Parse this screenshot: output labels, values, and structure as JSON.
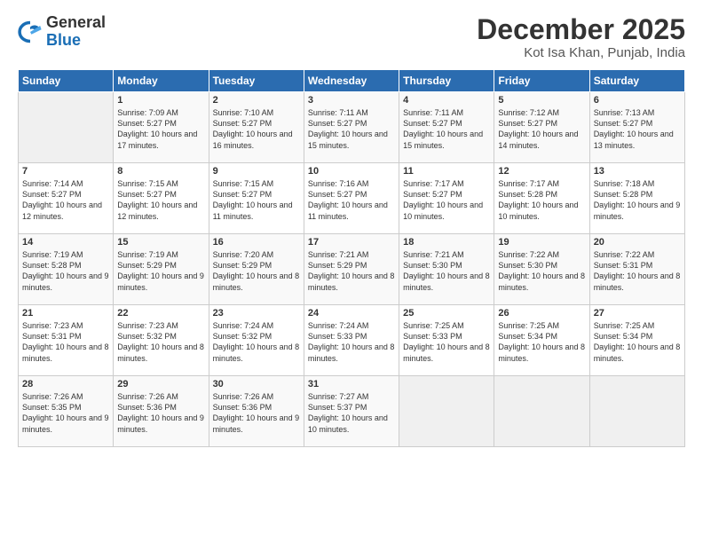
{
  "logo": {
    "general": "General",
    "blue": "Blue"
  },
  "title": "December 2025",
  "location": "Kot Isa Khan, Punjab, India",
  "days_of_week": [
    "Sunday",
    "Monday",
    "Tuesday",
    "Wednesday",
    "Thursday",
    "Friday",
    "Saturday"
  ],
  "weeks": [
    [
      {
        "day": "",
        "sunrise": "",
        "sunset": "",
        "daylight": ""
      },
      {
        "day": "1",
        "sunrise": "Sunrise: 7:09 AM",
        "sunset": "Sunset: 5:27 PM",
        "daylight": "Daylight: 10 hours and 17 minutes."
      },
      {
        "day": "2",
        "sunrise": "Sunrise: 7:10 AM",
        "sunset": "Sunset: 5:27 PM",
        "daylight": "Daylight: 10 hours and 16 minutes."
      },
      {
        "day": "3",
        "sunrise": "Sunrise: 7:11 AM",
        "sunset": "Sunset: 5:27 PM",
        "daylight": "Daylight: 10 hours and 15 minutes."
      },
      {
        "day": "4",
        "sunrise": "Sunrise: 7:11 AM",
        "sunset": "Sunset: 5:27 PM",
        "daylight": "Daylight: 10 hours and 15 minutes."
      },
      {
        "day": "5",
        "sunrise": "Sunrise: 7:12 AM",
        "sunset": "Sunset: 5:27 PM",
        "daylight": "Daylight: 10 hours and 14 minutes."
      },
      {
        "day": "6",
        "sunrise": "Sunrise: 7:13 AM",
        "sunset": "Sunset: 5:27 PM",
        "daylight": "Daylight: 10 hours and 13 minutes."
      }
    ],
    [
      {
        "day": "7",
        "sunrise": "Sunrise: 7:14 AM",
        "sunset": "Sunset: 5:27 PM",
        "daylight": "Daylight: 10 hours and 12 minutes."
      },
      {
        "day": "8",
        "sunrise": "Sunrise: 7:15 AM",
        "sunset": "Sunset: 5:27 PM",
        "daylight": "Daylight: 10 hours and 12 minutes."
      },
      {
        "day": "9",
        "sunrise": "Sunrise: 7:15 AM",
        "sunset": "Sunset: 5:27 PM",
        "daylight": "Daylight: 10 hours and 11 minutes."
      },
      {
        "day": "10",
        "sunrise": "Sunrise: 7:16 AM",
        "sunset": "Sunset: 5:27 PM",
        "daylight": "Daylight: 10 hours and 11 minutes."
      },
      {
        "day": "11",
        "sunrise": "Sunrise: 7:17 AM",
        "sunset": "Sunset: 5:27 PM",
        "daylight": "Daylight: 10 hours and 10 minutes."
      },
      {
        "day": "12",
        "sunrise": "Sunrise: 7:17 AM",
        "sunset": "Sunset: 5:28 PM",
        "daylight": "Daylight: 10 hours and 10 minutes."
      },
      {
        "day": "13",
        "sunrise": "Sunrise: 7:18 AM",
        "sunset": "Sunset: 5:28 PM",
        "daylight": "Daylight: 10 hours and 9 minutes."
      }
    ],
    [
      {
        "day": "14",
        "sunrise": "Sunrise: 7:19 AM",
        "sunset": "Sunset: 5:28 PM",
        "daylight": "Daylight: 10 hours and 9 minutes."
      },
      {
        "day": "15",
        "sunrise": "Sunrise: 7:19 AM",
        "sunset": "Sunset: 5:29 PM",
        "daylight": "Daylight: 10 hours and 9 minutes."
      },
      {
        "day": "16",
        "sunrise": "Sunrise: 7:20 AM",
        "sunset": "Sunset: 5:29 PM",
        "daylight": "Daylight: 10 hours and 8 minutes."
      },
      {
        "day": "17",
        "sunrise": "Sunrise: 7:21 AM",
        "sunset": "Sunset: 5:29 PM",
        "daylight": "Daylight: 10 hours and 8 minutes."
      },
      {
        "day": "18",
        "sunrise": "Sunrise: 7:21 AM",
        "sunset": "Sunset: 5:30 PM",
        "daylight": "Daylight: 10 hours and 8 minutes."
      },
      {
        "day": "19",
        "sunrise": "Sunrise: 7:22 AM",
        "sunset": "Sunset: 5:30 PM",
        "daylight": "Daylight: 10 hours and 8 minutes."
      },
      {
        "day": "20",
        "sunrise": "Sunrise: 7:22 AM",
        "sunset": "Sunset: 5:31 PM",
        "daylight": "Daylight: 10 hours and 8 minutes."
      }
    ],
    [
      {
        "day": "21",
        "sunrise": "Sunrise: 7:23 AM",
        "sunset": "Sunset: 5:31 PM",
        "daylight": "Daylight: 10 hours and 8 minutes."
      },
      {
        "day": "22",
        "sunrise": "Sunrise: 7:23 AM",
        "sunset": "Sunset: 5:32 PM",
        "daylight": "Daylight: 10 hours and 8 minutes."
      },
      {
        "day": "23",
        "sunrise": "Sunrise: 7:24 AM",
        "sunset": "Sunset: 5:32 PM",
        "daylight": "Daylight: 10 hours and 8 minutes."
      },
      {
        "day": "24",
        "sunrise": "Sunrise: 7:24 AM",
        "sunset": "Sunset: 5:33 PM",
        "daylight": "Daylight: 10 hours and 8 minutes."
      },
      {
        "day": "25",
        "sunrise": "Sunrise: 7:25 AM",
        "sunset": "Sunset: 5:33 PM",
        "daylight": "Daylight: 10 hours and 8 minutes."
      },
      {
        "day": "26",
        "sunrise": "Sunrise: 7:25 AM",
        "sunset": "Sunset: 5:34 PM",
        "daylight": "Daylight: 10 hours and 8 minutes."
      },
      {
        "day": "27",
        "sunrise": "Sunrise: 7:25 AM",
        "sunset": "Sunset: 5:34 PM",
        "daylight": "Daylight: 10 hours and 8 minutes."
      }
    ],
    [
      {
        "day": "28",
        "sunrise": "Sunrise: 7:26 AM",
        "sunset": "Sunset: 5:35 PM",
        "daylight": "Daylight: 10 hours and 9 minutes."
      },
      {
        "day": "29",
        "sunrise": "Sunrise: 7:26 AM",
        "sunset": "Sunset: 5:36 PM",
        "daylight": "Daylight: 10 hours and 9 minutes."
      },
      {
        "day": "30",
        "sunrise": "Sunrise: 7:26 AM",
        "sunset": "Sunset: 5:36 PM",
        "daylight": "Daylight: 10 hours and 9 minutes."
      },
      {
        "day": "31",
        "sunrise": "Sunrise: 7:27 AM",
        "sunset": "Sunset: 5:37 PM",
        "daylight": "Daylight: 10 hours and 10 minutes."
      },
      {
        "day": "",
        "sunrise": "",
        "sunset": "",
        "daylight": ""
      },
      {
        "day": "",
        "sunrise": "",
        "sunset": "",
        "daylight": ""
      },
      {
        "day": "",
        "sunrise": "",
        "sunset": "",
        "daylight": ""
      }
    ]
  ]
}
